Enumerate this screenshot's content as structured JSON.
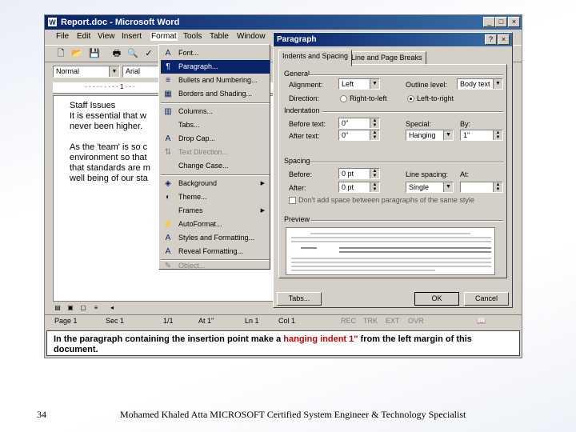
{
  "app": {
    "title": "Report.doc - Microsoft Word",
    "doc_icon": "W",
    "window_controls": [
      "_",
      "□",
      "×"
    ]
  },
  "menubar": [
    "File",
    "Edit",
    "View",
    "Insert",
    "Format",
    "Tools",
    "Table",
    "Window"
  ],
  "formatting": {
    "style": "Normal",
    "font": "Arial"
  },
  "document": {
    "lines": [
      "Staff Issues",
      "It is essential that w",
      "never been higher.",
      "",
      "As the 'team' is so c",
      "environment so that",
      "that standards are m",
      "well being of our sta"
    ]
  },
  "format_menu": [
    {
      "label": "Font...",
      "icon": "font-icon",
      "glyph": "A"
    },
    {
      "label": "Paragraph...",
      "icon": "paragraph-icon",
      "glyph": "¶",
      "highlighted": true
    },
    {
      "label": "Bullets and Numbering...",
      "icon": "bullets-icon",
      "glyph": "≡"
    },
    {
      "label": "Borders and Shading...",
      "icon": "borders-icon",
      "glyph": "▦"
    },
    {
      "label": "Columns...",
      "icon": "columns-icon",
      "glyph": "▥"
    },
    {
      "label": "Tabs...",
      "icon": "",
      "glyph": ""
    },
    {
      "label": "Drop Cap...",
      "icon": "drop-cap-icon",
      "glyph": "A"
    },
    {
      "label": "Text Direction...",
      "icon": "text-direction-icon",
      "glyph": "⇅",
      "disabled": true
    },
    {
      "label": "Change Case...",
      "icon": "",
      "glyph": ""
    },
    {
      "label": "Background",
      "icon": "background-icon",
      "glyph": "◈",
      "submenu": true
    },
    {
      "label": "Theme...",
      "icon": "theme-icon",
      "glyph": "◐"
    },
    {
      "label": "Frames",
      "icon": "",
      "glyph": "",
      "submenu": true
    },
    {
      "label": "AutoFormat...",
      "icon": "autoformat-icon",
      "glyph": "⚡"
    },
    {
      "label": "Styles and Formatting...",
      "icon": "styles-icon",
      "glyph": "A"
    },
    {
      "label": "Reveal Formatting...",
      "icon": "reveal-icon",
      "glyph": "A"
    },
    {
      "label": "Object...",
      "icon": "object-icon",
      "glyph": "✎",
      "disabled": true
    }
  ],
  "dialog": {
    "title": "Paragraph",
    "help": "?",
    "close": "×",
    "tabs": [
      "Indents and Spacing",
      "Line and Page Breaks"
    ],
    "general": {
      "heading": "General",
      "alignment_label": "Alignment:",
      "alignment_value": "Left",
      "outline_label": "Outline level:",
      "outline_value": "Body text",
      "direction_label": "Direction:",
      "rtl_label": "Right-to-left",
      "ltr_label": "Left-to-right"
    },
    "indentation": {
      "heading": "Indentation",
      "before_label": "Before text:",
      "before_value": "0\"",
      "after_label": "After text:",
      "after_value": "0\"",
      "special_label": "Special:",
      "special_value": "Hanging",
      "by_label": "By:",
      "by_value": "1\""
    },
    "spacing": {
      "heading": "Spacing",
      "before_label": "Before:",
      "before_value": "0 pt",
      "after_label": "After:",
      "after_value": "0 pt",
      "line_label": "Line spacing:",
      "line_value": "Single",
      "at_label": "At:",
      "at_value": "",
      "dont_add_label": "Don't add space between paragraphs of the same style"
    },
    "preview_heading": "Preview",
    "buttons": {
      "tabs": "Tabs...",
      "ok": "OK",
      "cancel": "Cancel"
    }
  },
  "statusbar": {
    "page": "Page 1",
    "sec": "Sec 1",
    "pages": "1/1",
    "at": "At 1\"",
    "ln": "Ln 1",
    "col": "Col 1",
    "indicators": [
      "REC",
      "TRK",
      "EXT",
      "OVR"
    ]
  },
  "instruction": {
    "part1": "In the paragraph containing the insertion point make a ",
    "highlight": "hanging indent 1\"",
    "part2": " from the left margin of this document.",
    "highlight_color": "#cc0000"
  },
  "footer": {
    "page_number": "34",
    "credit": "Mohamed Khaled Atta MICROSOFT Certified System Engineer & Technology Specialist"
  }
}
